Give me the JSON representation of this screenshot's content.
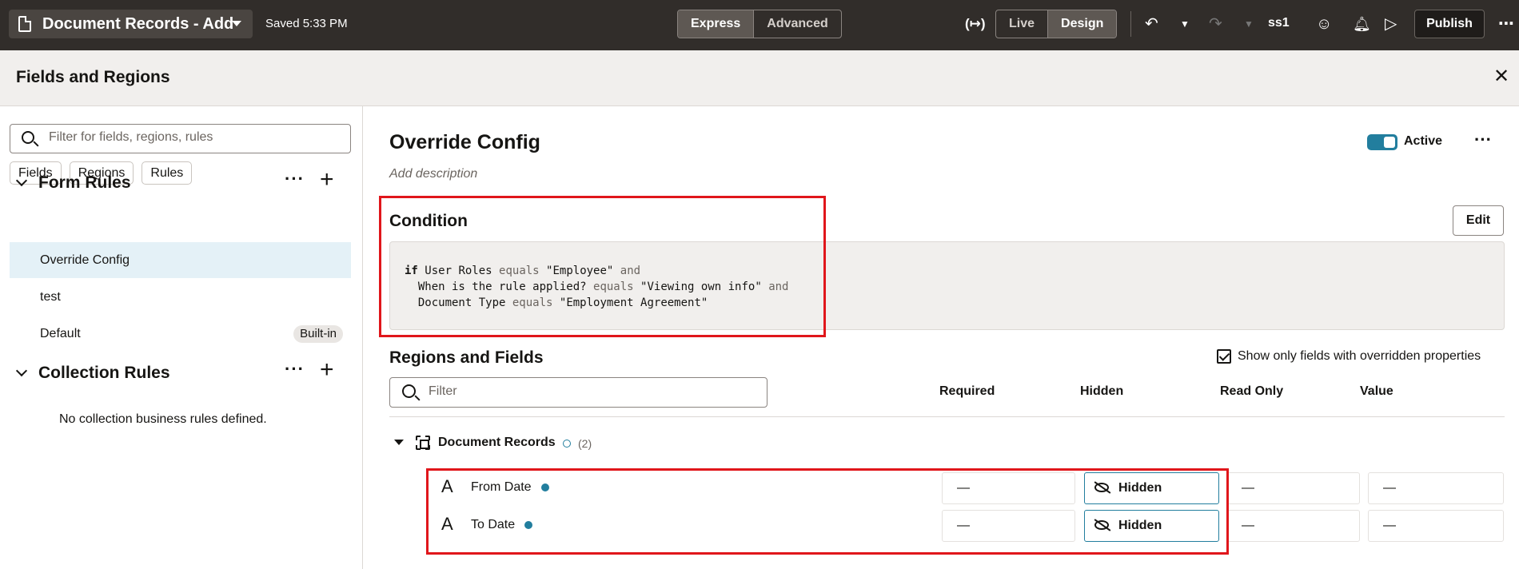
{
  "topbar": {
    "page_title": "Document Records - Add",
    "saved_status": "Saved 5:33 PM",
    "mode_express": "Express",
    "mode_advanced": "Advanced",
    "view_live": "Live",
    "view_design": "Design",
    "sandbox": "ss1",
    "publish": "Publish"
  },
  "panel": {
    "title": "Fields and Regions"
  },
  "left": {
    "search_placeholder": "Filter for fields, regions, rules",
    "chips": [
      "Fields",
      "Regions",
      "Rules"
    ],
    "form_rules_label": "Form Rules",
    "form_rules": [
      {
        "name": "Override Config",
        "selected": true
      },
      {
        "name": "test",
        "selected": false
      },
      {
        "name": "Default",
        "badge": "Built-in",
        "selected": false
      }
    ],
    "collection_rules_label": "Collection Rules",
    "collection_empty": "No collection business rules defined."
  },
  "rule": {
    "title": "Override Config",
    "description_placeholder": "Add description",
    "active_label": "Active",
    "condition_label": "Condition",
    "edit_label": "Edit",
    "condition": {
      "if": "if",
      "lines": [
        {
          "field": "User Roles",
          "op": "equals",
          "value": "\"Employee\"",
          "join": "and"
        },
        {
          "field": "When is the rule applied?",
          "op": "equals",
          "value": "\"Viewing own info\"",
          "join": "and"
        },
        {
          "field": "Document Type",
          "op": "equals",
          "value": "\"Employment Agreement\"",
          "join": ""
        }
      ]
    }
  },
  "regions": {
    "title": "Regions and Fields",
    "show_overridden_label": "Show only fields with overridden properties",
    "show_overridden_checked": true,
    "filter_placeholder": "Filter",
    "columns": [
      "Required",
      "Hidden",
      "Read Only",
      "Value"
    ],
    "group": {
      "name": "Document Records",
      "count": "(2)"
    },
    "fields": [
      {
        "name": "From Date",
        "required": "—",
        "hidden": "Hidden",
        "read_only": "—",
        "value": "—"
      },
      {
        "name": "To Date",
        "required": "—",
        "hidden": "Hidden",
        "read_only": "—",
        "value": "—"
      }
    ]
  },
  "colors": {
    "accent": "#227e9e",
    "highlight_box": "#e0161b",
    "topbar_bg": "#312d2a"
  }
}
